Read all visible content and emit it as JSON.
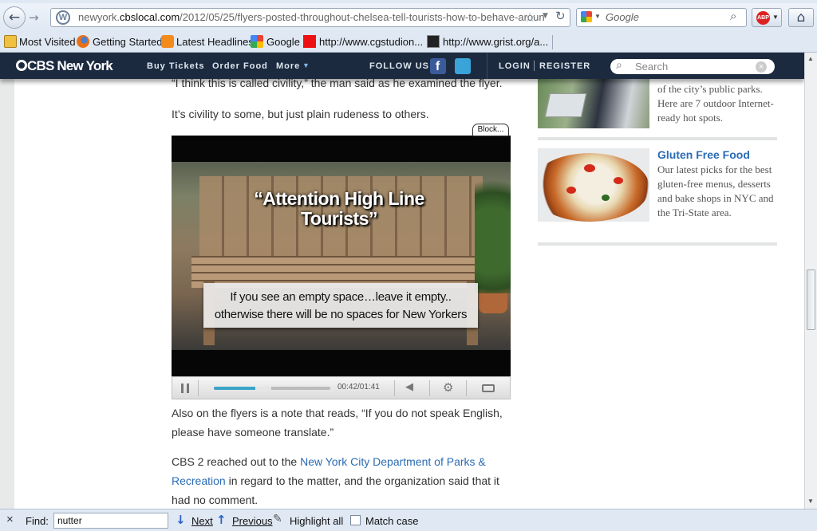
{
  "browser": {
    "url_prefix": "newyork.",
    "url_domain": "cbslocal.com",
    "url_path": "/2012/05/25/flyers-posted-throughout-chelsea-tell-tourists-how-to-behave-aroun",
    "search_placeholder": "Google",
    "abp_label": "ABP",
    "bookmarks": [
      "Most Visited",
      "Getting Started",
      "Latest Headlines",
      "Google",
      "http://www.cgstudion...",
      "http://www.grist.org/a..."
    ]
  },
  "site": {
    "logo": "CBS New York",
    "nav": [
      "Buy Tickets",
      "Order Food",
      "More"
    ],
    "follow_us": "FOLLOW US",
    "login": "LOGIN",
    "register": "REGISTER",
    "search_placeholder": "Search"
  },
  "article": {
    "quote": "“I think this is called civility,” the man said as he examined the flyer.",
    "p1": "It’s civility to some, but just plain rudeness to others.",
    "block_label": "Block...",
    "video_title": "“Attention High Line Tourists”",
    "video_caption1": "If you see an empty space…leave it empty..",
    "video_caption2": "otherwise there will be no spaces for New Yorkers",
    "video_time": "00:42/01:41",
    "video_progress": 0.42,
    "p2": "Also on the flyers is a note that reads, “If you do not speak English, please have someone translate.”",
    "p3_start": "CBS 2 reached out to the ",
    "p3_link": "New York City Department of Parks  & Recreation",
    "p3_end": " in regard to the matter, and the organization said that it had no comment."
  },
  "sidebar": {
    "item1_desc": "of the city’s public parks. Here are 7 outdoor Internet-ready hot spots.",
    "item2_title": "Gluten Free Food",
    "item2_desc": "Our latest picks for the best gluten-free menus, desserts and bake shops in NYC and the Tri-State area."
  },
  "findbar": {
    "close": "×",
    "label": "Find:",
    "value": "nutter",
    "next": "Next",
    "previous": "Previous",
    "highlight": "Highlight all",
    "match_case": "Match case"
  }
}
